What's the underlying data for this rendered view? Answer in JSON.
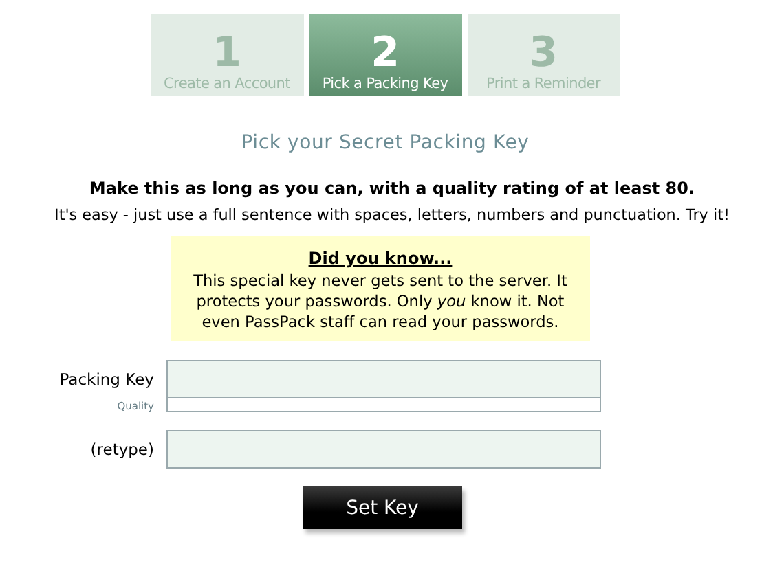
{
  "steps": [
    {
      "number": "1",
      "label": "Create an Account",
      "selected": false
    },
    {
      "number": "2",
      "label": "Pick a Packing Key",
      "selected": true
    },
    {
      "number": "3",
      "label": "Print a Reminder",
      "selected": false
    }
  ],
  "heading": "Pick your Secret Packing Key",
  "instructions": {
    "main": "Make this as long as you can, with a quality rating of at least 80.",
    "hint": "It's easy - just use a full sentence with spaces, letters, numbers and punctuation. Try it!"
  },
  "notice": {
    "title": "Did you know...",
    "body": "This special key never gets sent to the server. It protects your passwords. Only *you* know it. Not even PassPack staff can read your passwords."
  },
  "form": {
    "fields": [
      {
        "label": "Packing Key",
        "kind": "key",
        "quality": {
          "label": "Quality",
          "level": 0
        }
      },
      {
        "label": "(retype)",
        "kind": "plain"
      }
    ],
    "submit": "Set Key"
  }
}
